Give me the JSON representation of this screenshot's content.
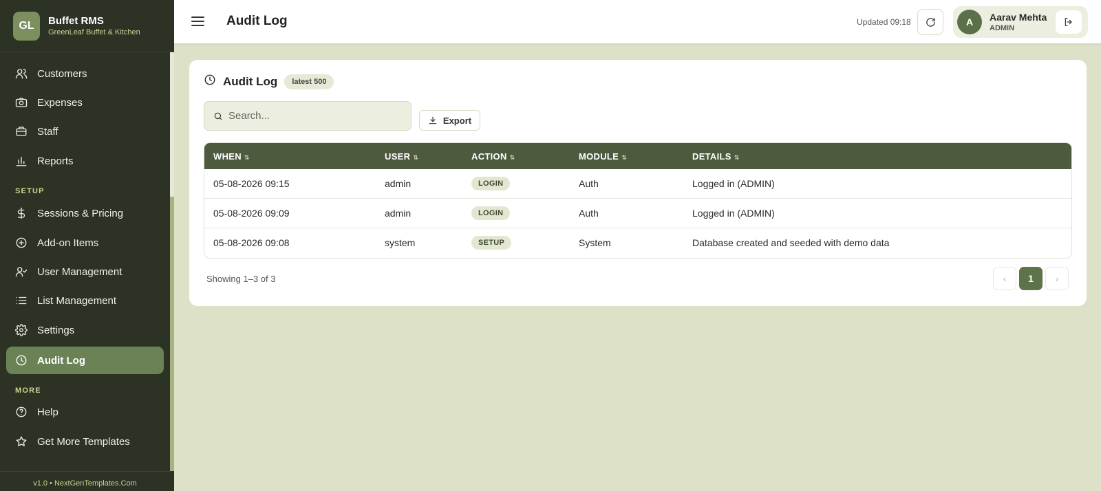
{
  "brand": {
    "logo": "GL",
    "name": "Buffet RMS",
    "subtitle": "GreenLeaf Buffet & Kitchen"
  },
  "sidebar": {
    "items": [
      {
        "label": "Customers",
        "icon": "users-icon"
      },
      {
        "label": "Expenses",
        "icon": "camera-icon"
      },
      {
        "label": "Staff",
        "icon": "briefcase-icon"
      },
      {
        "label": "Reports",
        "icon": "bar-chart-icon"
      }
    ],
    "setup_label": "SETUP",
    "setup_items": [
      {
        "label": "Sessions & Pricing",
        "icon": "dollar-icon"
      },
      {
        "label": "Add-on Items",
        "icon": "plus-circle-icon"
      },
      {
        "label": "User Management",
        "icon": "user-check-icon"
      },
      {
        "label": "List Management",
        "icon": "list-icon"
      },
      {
        "label": "Settings",
        "icon": "gear-icon"
      },
      {
        "label": "Audit Log",
        "icon": "clock-icon",
        "active": true
      }
    ],
    "more_label": "MORE",
    "more_items": [
      {
        "label": "Help",
        "icon": "help-circle-icon"
      },
      {
        "label": "Get More Templates",
        "icon": "star-icon"
      }
    ],
    "footer": "v1.0 • NextGenTemplates.Com"
  },
  "header": {
    "title": "Audit Log",
    "updated": "Updated 09:18",
    "user": {
      "initial": "A",
      "name": "Aarav Mehta",
      "role": "ADMIN"
    }
  },
  "card": {
    "title": "Audit Log",
    "badge": "latest 500",
    "search_placeholder": "Search...",
    "export_label": "Export",
    "columns": [
      "WHEN",
      "USER",
      "ACTION",
      "MODULE",
      "DETAILS"
    ],
    "rows": [
      {
        "when": "05-08-2026 09:15",
        "user": "admin",
        "action": "LOGIN",
        "module": "Auth",
        "details": "Logged in (ADMIN)"
      },
      {
        "when": "05-08-2026 09:09",
        "user": "admin",
        "action": "LOGIN",
        "module": "Auth",
        "details": "Logged in (ADMIN)"
      },
      {
        "when": "05-08-2026 09:08",
        "user": "system",
        "action": "SETUP",
        "module": "System",
        "details": "Database created and seeded with demo data"
      }
    ],
    "showing": "Showing 1–3 of 3",
    "pagination": {
      "prev": "‹",
      "current": "1",
      "next": "›"
    }
  },
  "colors": {
    "sidebar_bg": "#2c3325",
    "accent": "#6b8257",
    "page_bg": "#dde1c8",
    "table_header": "#4d5a3e"
  }
}
